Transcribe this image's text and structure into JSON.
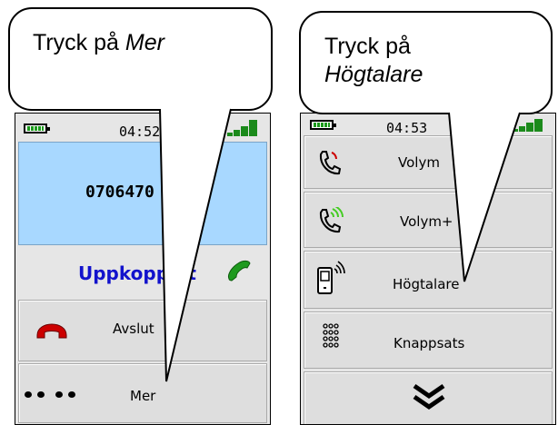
{
  "left_phone": {
    "callout_prefix": "Tryck på ",
    "callout_emph": "Mer",
    "time": "04:52",
    "number": "0706470",
    "status": "Uppkopplat",
    "buttons": {
      "end_label": "Avslut",
      "more_label": "Mer"
    }
  },
  "right_phone": {
    "callout_prefix": "Tryck på",
    "callout_emph": "Högtalare",
    "time": "04:53",
    "menu": [
      {
        "label": "Volym",
        "icon": "phone-volume-down-icon"
      },
      {
        "label": "Volym+",
        "icon": "phone-volume-up-icon"
      },
      {
        "label": "Högtalare",
        "icon": "speakerphone-icon"
      },
      {
        "label": "Knappsats",
        "icon": "keypad-icon"
      }
    ],
    "scroll_icon": "double-chevron-down-icon"
  },
  "colors": {
    "number_panel": "#a8d8ff",
    "status_text": "#1212cc",
    "signal": "#1b8a1b",
    "end_call": "#cc0000",
    "accept_call": "#1f9a1f"
  }
}
